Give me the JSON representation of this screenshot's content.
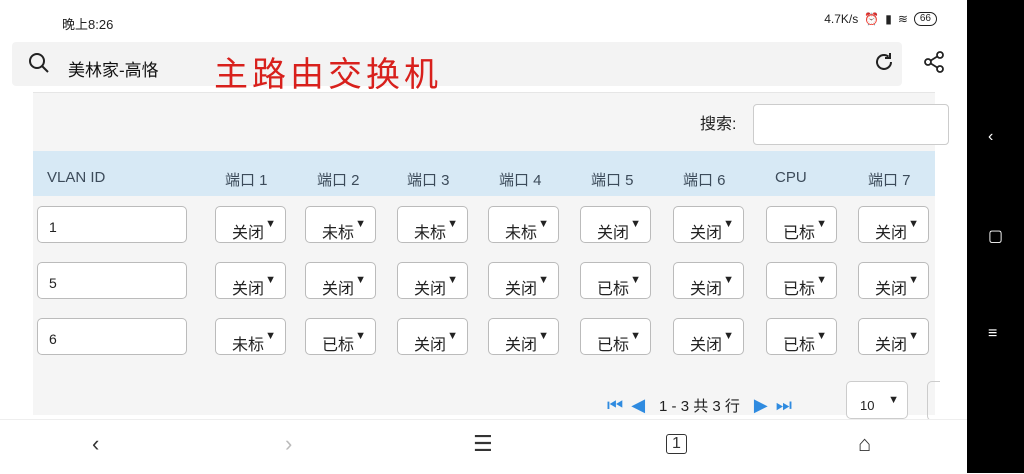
{
  "status_bar": {
    "time": "晚上8:26",
    "speed": "4.7K/s",
    "battery": "66"
  },
  "browser": {
    "page_title": "美林家-高恪",
    "overlay_text": "主路由交换机"
  },
  "search": {
    "label": "搜索:",
    "placeholder": ""
  },
  "table": {
    "columns": [
      "VLAN ID",
      "端口 1",
      "端口 2",
      "端口 3",
      "端口 4",
      "端口 5",
      "端口 6",
      "CPU",
      "端口 7"
    ],
    "rows": [
      {
        "vlan": "1",
        "ports": [
          "关闭",
          "未标",
          "未标",
          "未标",
          "关闭",
          "关闭",
          "已标",
          "关闭"
        ]
      },
      {
        "vlan": "5",
        "ports": [
          "关闭",
          "关闭",
          "关闭",
          "关闭",
          "已标",
          "关闭",
          "已标",
          "关闭"
        ]
      },
      {
        "vlan": "6",
        "ports": [
          "未标",
          "已标",
          "关闭",
          "关闭",
          "已标",
          "关闭",
          "已标",
          "关闭"
        ]
      }
    ]
  },
  "pagination": {
    "info": "1 - 3 共 3 行",
    "page_size": "10"
  },
  "icons": {
    "search": "search-icon",
    "refresh": "refresh-icon",
    "share": "share-icon"
  }
}
